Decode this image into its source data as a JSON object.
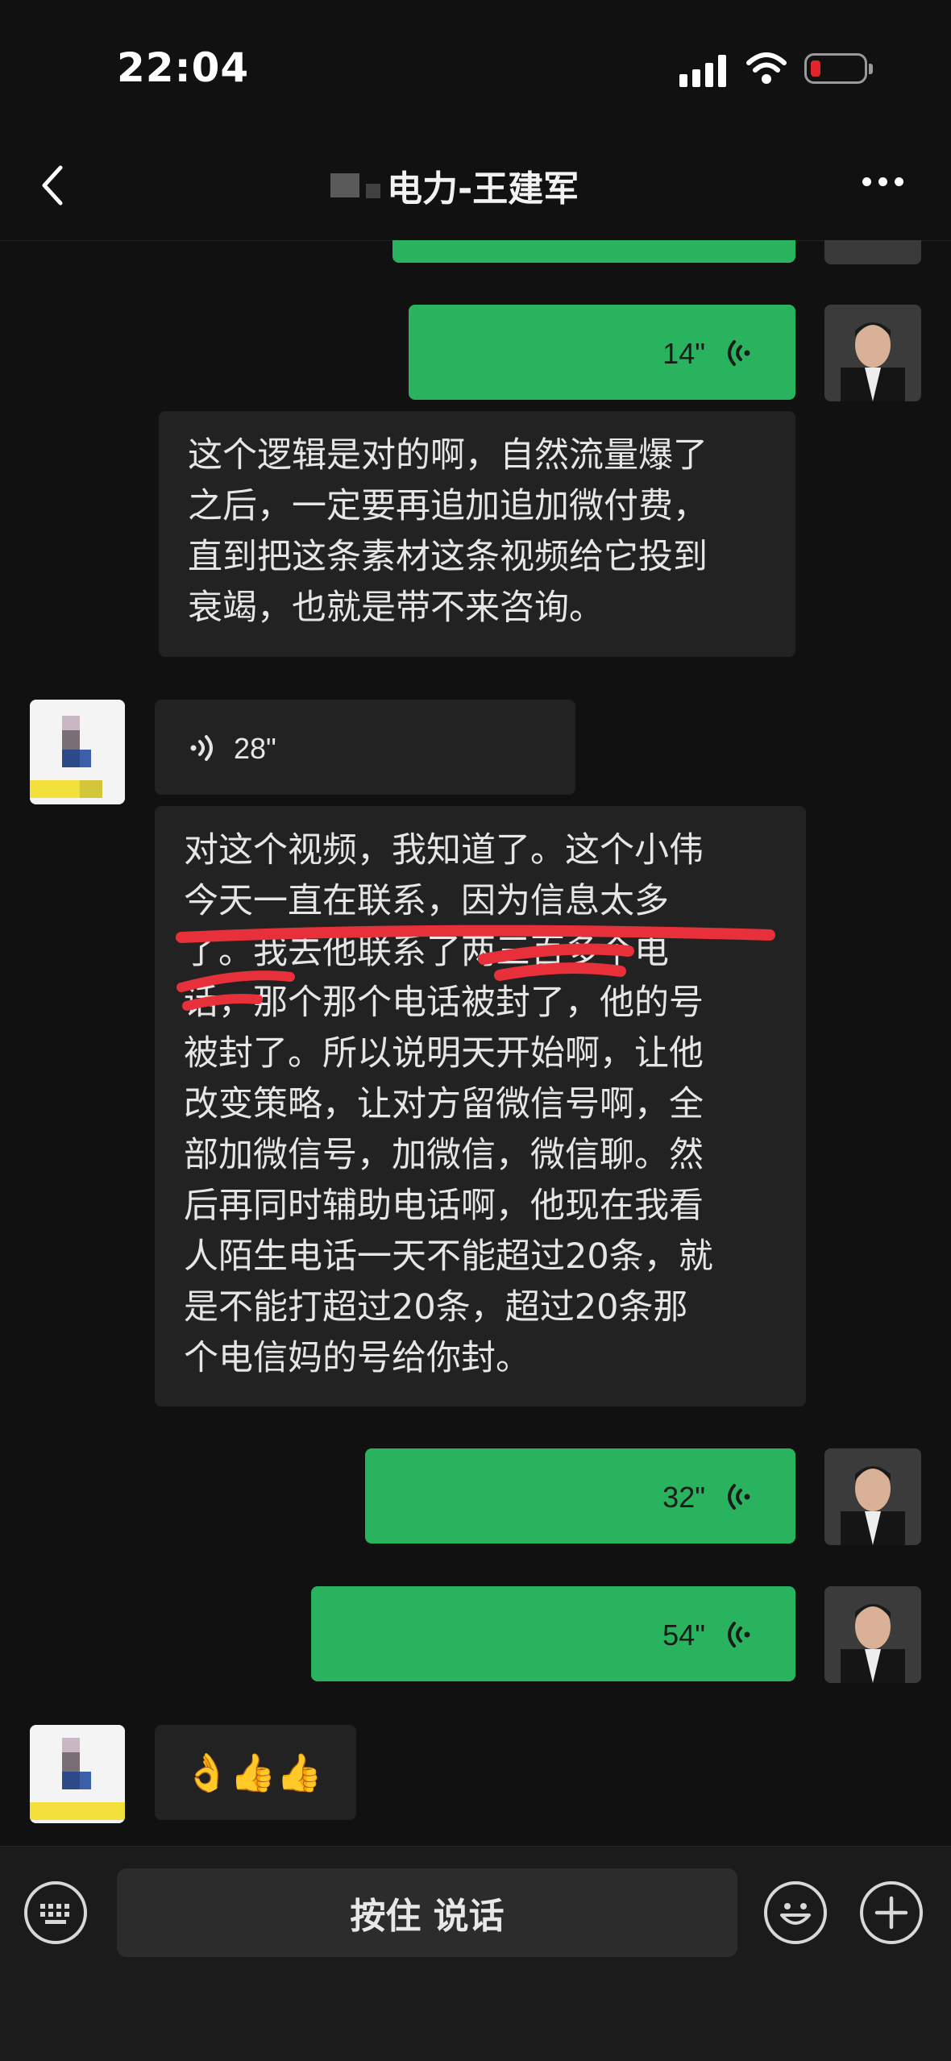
{
  "status_bar": {
    "time": "22:04"
  },
  "nav": {
    "title": "电力-王建军"
  },
  "messages": [
    {
      "side": "right",
      "type": "voice",
      "duration": "14\""
    },
    {
      "side": "right",
      "type": "text",
      "text": "这个逻辑是对的啊，自然流量爆了之后，一定要再追加追加微付费，直到把这条素材这条视频给它投到衰竭，也就是带不来咨询。"
    },
    {
      "side": "left",
      "type": "voice",
      "duration": "28\""
    },
    {
      "side": "left",
      "type": "text",
      "text": "对这个视频，我知道了。这个小伟今天一直在联系，因为信息太多了。我去他联系了两三百多个电话，那个那个电话被封了，他的号被封了。所以说明天开始啊，让他改变策略，让对方留微信号啊，全部加微信号，加微信，微信聊。然后再同时辅助电话啊，他现在我看人陌生电话一天不能超过20条，就是不能打超过20条，超过20条那个电信妈的号给你封。"
    },
    {
      "side": "right",
      "type": "voice",
      "duration": "32\""
    },
    {
      "side": "right",
      "type": "voice",
      "duration": "54\""
    },
    {
      "side": "left",
      "type": "emoji",
      "text": "👌👍👍"
    }
  ],
  "msg_lines": {
    "m1": [
      "这个逻辑是对的啊，自然流量爆了",
      "之后，一定要再追加追加微付费，",
      "直到把这条素材这条视频给它投到",
      "衰竭，也就是带不来咨询。"
    ],
    "m3": [
      "对这个视频，我知道了。这个小伟",
      "今天一直在联系，因为信息太多",
      "了。我去他联系了两三百多个电",
      "话，那个那个电话被封了，他的号",
      "被封了。所以说明天开始啊，让他",
      "改变策略，让对方留微信号啊，全",
      "部加微信号，加微信，微信聊。然",
      "后再同时辅助电话啊，他现在我看",
      "人陌生电话一天不能超过20条，就",
      "是不能打超过20条，超过20条那",
      "个电信妈的号给你封。"
    ]
  },
  "input_bar": {
    "hold_to_talk": "按住 说话"
  },
  "icons": {
    "back": "chevron-left-icon",
    "more": "more-icon",
    "keyboard": "keyboard-icon",
    "emoji": "emoji-icon",
    "plus": "plus-icon",
    "voice": "voice-wave-icon"
  },
  "colors": {
    "bubble_green": "#29b35e",
    "bubble_dark": "#222222",
    "background": "#111111",
    "annotation_red": "#e8303a"
  }
}
